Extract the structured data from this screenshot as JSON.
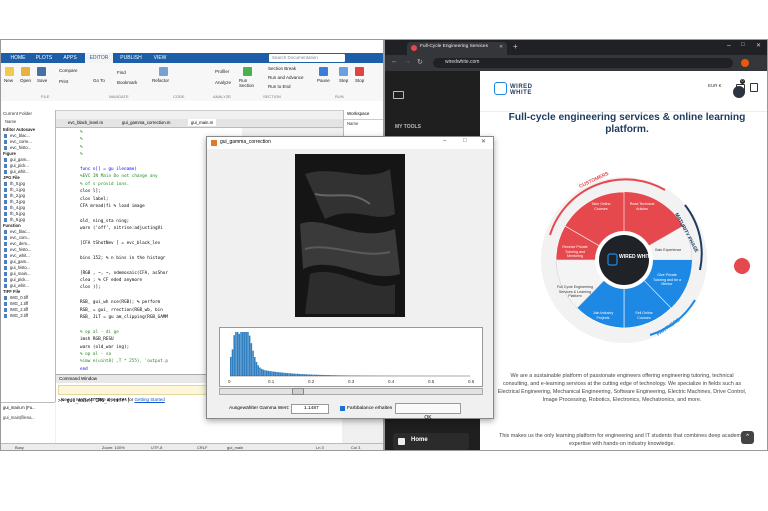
{
  "matlab": {
    "tabs": [
      "HOME",
      "PLOTS",
      "APPS",
      "EDITOR",
      "PUBLISH",
      "VIEW"
    ],
    "active_tab": "EDITOR",
    "search_placeholder": "Search Documentation",
    "toolstrip": {
      "file": [
        "New",
        "Open",
        "Save"
      ],
      "file_small": [
        "Compare",
        "Print"
      ],
      "navigate": [
        "Go To",
        "Find",
        "Bookmark"
      ],
      "code": [
        "Refactor"
      ],
      "analyze": [
        "Profiler",
        "Analyze"
      ],
      "section": [
        "Run Section",
        "Section Break",
        "Run and Advance",
        "Run to End"
      ],
      "run": [
        "Pause",
        "Step",
        "Stop"
      ],
      "groups": [
        "FILE",
        "NAVIGATE",
        "CODE",
        "ANALYZE",
        "SECTION",
        "RUN"
      ]
    },
    "current_folder_label": "Current Folder",
    "name_header": "Name",
    "folder_groups": [
      {
        "title": "Editor Autosave",
        "items": [
          "evc_blac...",
          "evc_corre...",
          "evc_histo..."
        ]
      },
      {
        "title": "Figure",
        "items": [
          "gui_gam...",
          "gui_pick...",
          "gui_whit..."
        ]
      },
      {
        "title": "JPG File",
        "items": [
          "th_0.jpg",
          "th_1.jpg",
          "th_2.jpg",
          "th_3.jpg",
          "th_4.jpg",
          "th_5.jpg",
          "th_6.jpg"
        ]
      },
      {
        "title": "Function",
        "items": [
          "evc_blac...",
          "evc_com...",
          "evc_dem...",
          "evc_histo...",
          "evc_whit...",
          "gui_gam...",
          "gui_histo...",
          "gui_main...",
          "gui_pick...",
          "gui_whit..."
        ]
      },
      {
        "title": "TIFF File",
        "items": [
          "IMG_0.tiff",
          "IMG_1.tiff",
          "IMG_2.tiff",
          "IMG_3.tiff"
        ]
      }
    ],
    "folder_selected": "gui_main.m (Fu...",
    "folder_detail": "gui_main(filena...",
    "editor_tabs": [
      "evc_black_level.m",
      "gui_gamma_correction.m",
      "gui_main.m"
    ],
    "workspace_label": "Workspace",
    "code_lines": [
      {
        "n": "",
        "text": "%"
      },
      {
        "n": "",
        "text": "%"
      },
      {
        "n": "",
        "text": "%"
      },
      {
        "n": "",
        "text": "%"
      },
      {
        "n": "",
        "text": ""
      },
      {
        "n": "",
        "text": "func    n[] = gu         ilename)"
      },
      {
        "n": "",
        "text": "%EVC    IN Main          Do not change any"
      },
      {
        "n": "",
        "text": "% of    s provid       ions."
      },
      {
        "n": "",
        "text": "clos    l];"
      },
      {
        "n": "",
        "text": "clos    label;"
      },
      {
        "n": "",
        "text": "CFA     mread(fi       % load image"
      },
      {
        "n": "",
        "text": ""
      },
      {
        "n": "",
        "text": "old_    ning_sta       ning;"
      },
      {
        "n": "",
        "text": "warn    ('off',         nitrise:adjustingVi"
      },
      {
        "n": "",
        "text": ""
      },
      {
        "n": "",
        "text": "[CFA    tShotNev       ] = evc_black_lev"
      },
      {
        "n": "",
        "text": ""
      },
      {
        "n": "",
        "text": "bins    152; % n        bins in the histogr"
      },
      {
        "n": "",
        "text": ""
      },
      {
        "n": "",
        "text": "[RGB    , ~, ~,        ndemosaic(CFA, asShor"
      },
      {
        "n": "",
        "text": "clea    ; % CF      eded anymore"
      },
      {
        "n": "",
        "text": "clos    )];"
      },
      {
        "n": "",
        "text": ""
      },
      {
        "n": "",
        "text": "RGB_    gui_wh      nce(RGB); % perform"
      },
      {
        "n": "",
        "text": "RGB_    = gui_      rrection(RGB_wb, bin"
      },
      {
        "n": "",
        "text": "RGB_    JLT = gu       am_clipping(RGB_GAMM"
      },
      {
        "n": "",
        "text": ""
      },
      {
        "n": "",
        "text": "% op    al - di        ge"
      },
      {
        "n": "",
        "text": "imsh    RGB_RESU"
      },
      {
        "n": "",
        "text": "warn    (old_war        ing);"
      },
      {
        "n": "",
        "text": "% op    al - sa"
      },
      {
        "n": "",
        "text": "%imw    e(uint8(       ,T * 255), 'output.p"
      },
      {
        "n": "",
        "text": "end"
      }
    ],
    "command_window_label": "Command Window",
    "cmd_notice": "New to MATLAB? See resources for ",
    "cmd_link": "Getting Started",
    "cmd_line": ">> gui_main('IMG_4.tiff')",
    "status": {
      "busy": "Busy",
      "zoom": "Zoom: 100%",
      "enc": "UTF-8",
      "eol": "CRLF",
      "file": "gui_main",
      "ln": "Ln  3",
      "col": "Col  3"
    }
  },
  "figure": {
    "title": "gui_gamma_correction",
    "hist_ticks": [
      "0",
      "0.1",
      "0.2",
      "0.3",
      "0.4",
      "0.5",
      "0.6"
    ],
    "gamma_label": "Ausgewählter Gamma Wert:",
    "gamma_value": "1.1487",
    "checkbox_label": "Farbbalance erhalten",
    "ok_label": "OK"
  },
  "browser": {
    "tab_title": "Full-Cycle Engineering Services",
    "url": "wiredwhite.com",
    "sidebar_header": "MY TOOLS",
    "sidebar_home": "Home",
    "logo_text": "WIRED WHITE",
    "currency": "EUR €",
    "cart_count": "0",
    "headline": "Full-cycle engineering services & online learning platform.",
    "wheel": {
      "customers": "CUSTOMERS",
      "maturity": "MATURITY PHASE",
      "partners": "PARTNERS",
      "segments": [
        "Take Online Courses",
        "Read Technical Articles",
        "Gain Experience",
        "Give Private Tutoring and be a Mentor",
        "Sell Online Courses",
        "Join Industry Projects",
        "Receive Private Tutoring and Mentoring"
      ],
      "center_left": "Full Cycle Engineering Services & Learning Platform",
      "center_logo": "WIRED WHITE"
    },
    "para1": "We are a sustainable platform of passionate engineers offering engineering tutoring, technical consulting, and e-learning services at the cutting edge of technology. We specialize in fields such as Electrical Engineering, Mechanical Engineering, Software Engineering, Electric Machines, Drive Control, Image Processing, Robotics, Electronics, Mechatronics, and more.",
    "para2": "This makes us the only learning platform for engineering and IT students that combines deep academic expertise with hands-on industry knowledge."
  },
  "colors": {
    "matlab_blue": "#1c5fa8",
    "red": "#e5484d",
    "blue": "#1e88e5",
    "dark": "#202124"
  }
}
